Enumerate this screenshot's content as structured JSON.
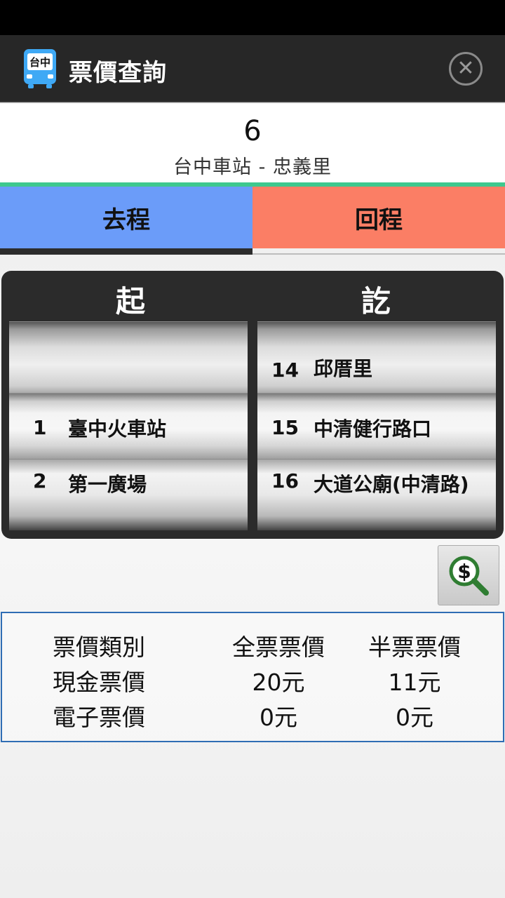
{
  "app": {
    "icon_label": "台中",
    "title": "票價查詢"
  },
  "route": {
    "number": "6",
    "name": "台中車站 - 忠義里"
  },
  "tabs": [
    {
      "label": "去程",
      "selected": true,
      "color": "#6b9cf9"
    },
    {
      "label": "回程",
      "selected": false,
      "color": "#fb7e65"
    }
  ],
  "picker": {
    "start_header": "起",
    "end_header": "訖",
    "start_rows": [
      {
        "num": "",
        "name": ""
      },
      {
        "num": "1",
        "name": "臺中火車站"
      },
      {
        "num": "2",
        "name": "第一廣場"
      }
    ],
    "end_rows": [
      {
        "num": "14",
        "name": "邱厝里"
      },
      {
        "num": "15",
        "name": "中清健行路口"
      },
      {
        "num": "16",
        "name": "大道公廟(中清路)"
      }
    ]
  },
  "fare_table": {
    "headers": [
      "票價類別",
      "全票票價",
      "半票票價"
    ],
    "rows": [
      [
        "現金票價",
        "20元",
        "11元"
      ],
      [
        "電子票價",
        "0元",
        "0元"
      ]
    ]
  },
  "colors": {
    "title_bar": "#272727",
    "accent_line": "#3ec88e",
    "fare_border": "#2f6db4"
  }
}
